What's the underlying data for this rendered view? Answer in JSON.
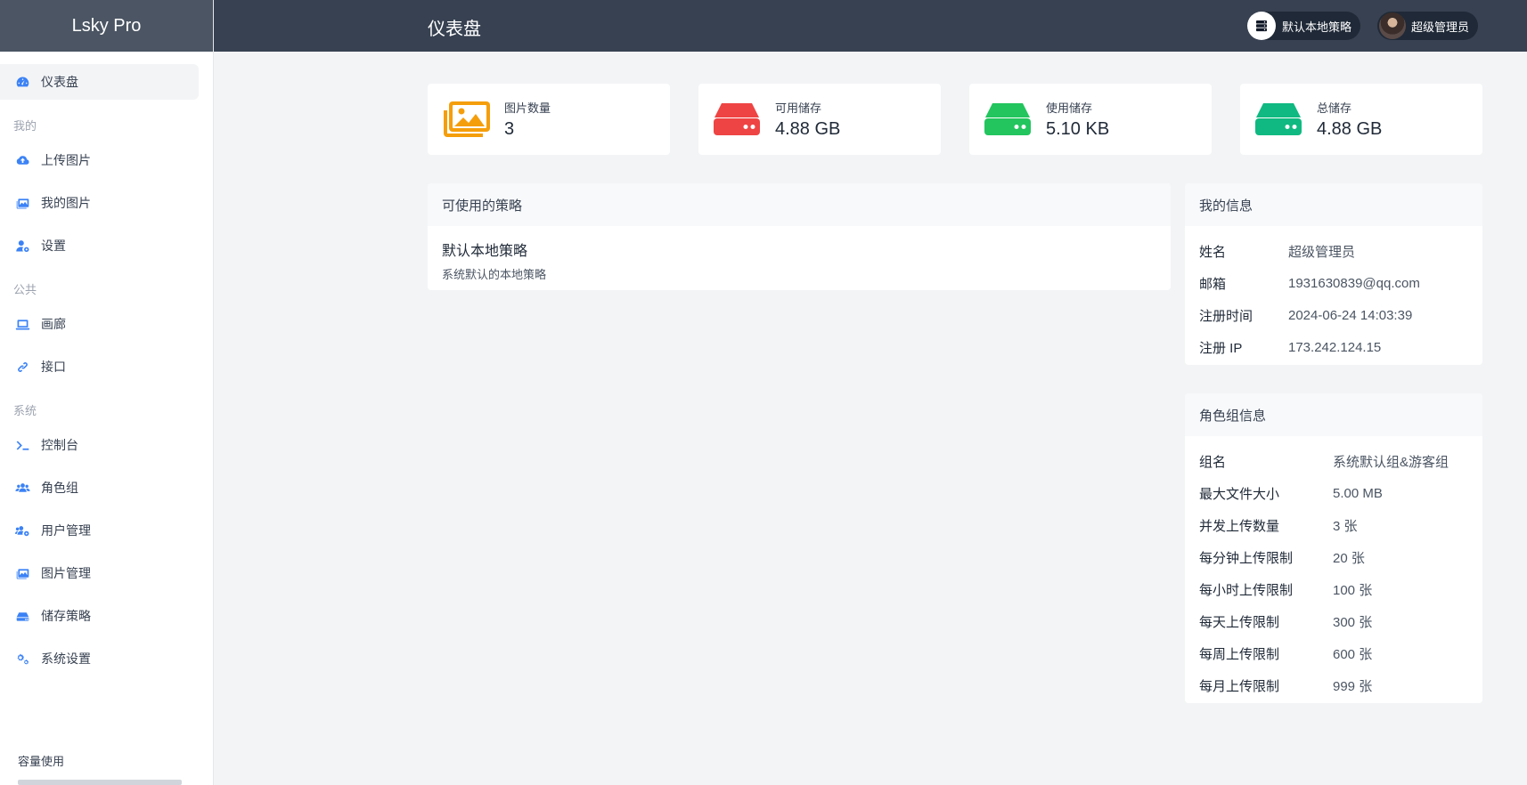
{
  "sidebar": {
    "brand": "Lsky Pro",
    "active_item": "仪表盘",
    "sections": {
      "mine": "我的",
      "public": "公共",
      "system": "系统"
    },
    "items": {
      "dashboard": "仪表盘",
      "upload": "上传图片",
      "my_images": "我的图片",
      "settings": "设置",
      "gallery": "画廊",
      "api": "接口",
      "console": "控制台",
      "roles": "角色组",
      "users": "用户管理",
      "images_admin": "图片管理",
      "storage": "储存策略",
      "system_settings": "系统设置"
    },
    "capacity_label": "容量使用",
    "icons": {
      "dashboard": "gauge-icon",
      "upload": "cloud-upload-icon",
      "my_images": "images-icon",
      "settings": "user-gear-icon",
      "gallery": "laptop-icon",
      "api": "link-icon",
      "console": "terminal-icon",
      "roles": "users-icon",
      "users": "users-gear-icon",
      "images_admin": "images-icon",
      "storage": "hard-drive-icon",
      "system_settings": "gears-icon"
    }
  },
  "header": {
    "title": "仪表盘",
    "strategy_label": "默认本地策略",
    "user_label": "超级管理员"
  },
  "stats": [
    {
      "label": "图片数量",
      "value": "3",
      "icon": "images-icon",
      "color": "#f59e0b"
    },
    {
      "label": "可用储存",
      "value": "4.88 GB",
      "icon": "hard-drive-icon",
      "color": "#ef4444"
    },
    {
      "label": "使用储存",
      "value": "5.10 KB",
      "icon": "hard-drive-icon",
      "color": "#22c55e"
    },
    {
      "label": "总储存",
      "value": "4.88 GB",
      "icon": "hard-drive-icon",
      "color": "#10b981"
    }
  ],
  "policies": {
    "title": "可使用的策略",
    "items": [
      {
        "name": "默认本地策略",
        "desc": "系统默认的本地策略"
      }
    ]
  },
  "my_info": {
    "title": "我的信息",
    "rows": [
      {
        "key": "姓名",
        "value": "超级管理员"
      },
      {
        "key": "邮箱",
        "value": "1931630839@qq.com"
      },
      {
        "key": "注册时间",
        "value": "2024-06-24 14:03:39"
      },
      {
        "key": "注册 IP",
        "value": "173.242.124.15"
      }
    ]
  },
  "role_info": {
    "title": "角色组信息",
    "rows": [
      {
        "key": "组名",
        "value": "系统默认组&游客组"
      },
      {
        "key": "最大文件大小",
        "value": "5.00 MB"
      },
      {
        "key": "并发上传数量",
        "value": "3 张"
      },
      {
        "key": "每分钟上传限制",
        "value": "20 张"
      },
      {
        "key": "每小时上传限制",
        "value": "100 张"
      },
      {
        "key": "每天上传限制",
        "value": "300 张"
      },
      {
        "key": "每周上传限制",
        "value": "600 张"
      },
      {
        "key": "每月上传限制",
        "value": "999 张"
      }
    ]
  }
}
